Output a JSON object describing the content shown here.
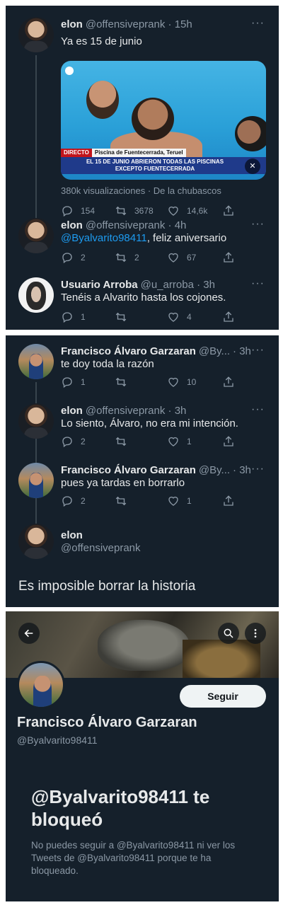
{
  "colors": {
    "background": "#15202b",
    "text": "#e7e9ea",
    "secondary": "#8b98a5",
    "link": "#1d9bf0"
  },
  "tweets": [
    {
      "name": "elon",
      "handle": "@offensiveprank · 15h",
      "text": "Ya es 15 de junio",
      "media": {
        "chyron_live": "DIRECTO",
        "chyron_location": "Piscina de Fuentecerrada, Teruel",
        "chyron_line1": "EL 15 DE JUNIO ABRIERON TODAS LAS PISCINAS",
        "chyron_line2": "EXCEPTO FUENTECERRADA"
      },
      "views": "380k visualizaciones · De la chubascos",
      "replies": "154",
      "retweets": "3678",
      "likes": "14,6k"
    },
    {
      "name": "elon",
      "handle": "@offensiveprank · 4h",
      "mention": "@Byalvarito98411",
      "text": ", feliz aniversario",
      "replies": "2",
      "retweets": "2",
      "likes": "67"
    },
    {
      "name": "Usuario Arroba",
      "handle": "@u_arroba · 3h",
      "text": "Tenéis a Alvarito hasta los cojones.",
      "replies": "1",
      "retweets": "",
      "likes": "4"
    },
    {
      "name": "Francisco Álvaro Garzaran",
      "handle": "@By...",
      "time": "· 3h",
      "text": "te doy toda la razón",
      "replies": "1",
      "retweets": "",
      "likes": "10"
    },
    {
      "name": "elon",
      "handle": "@offensiveprank · 3h",
      "text": "Lo siento, Álvaro, no era mi intención.",
      "replies": "2",
      "retweets": "",
      "likes": "1"
    },
    {
      "name": "Francisco Álvaro Garzaran",
      "handle": "@By...",
      "time": "· 3h",
      "text": "pues ya tardas en borrarlo",
      "replies": "2",
      "retweets": "",
      "likes": "1"
    }
  ],
  "composer": {
    "name": "elon",
    "handle": "@offensiveprank",
    "text": "Es imposible borrar la historia"
  },
  "profile": {
    "follow_label": "Seguir",
    "name": "Francisco Álvaro Garzaran",
    "handle": "@Byalvarito98411",
    "blocked_title": "@Byalvarito98411 te bloqueó",
    "blocked_desc": "No puedes seguir a @Byalvarito98411 ni ver los Tweets de @Byalvarito98411 porque te ha bloqueado."
  },
  "icons": [
    "reply-icon",
    "retweet-icon",
    "like-icon",
    "share-icon",
    "more-icon",
    "back-arrow-icon",
    "search-icon",
    "more-vertical-icon",
    "mute-icon"
  ]
}
